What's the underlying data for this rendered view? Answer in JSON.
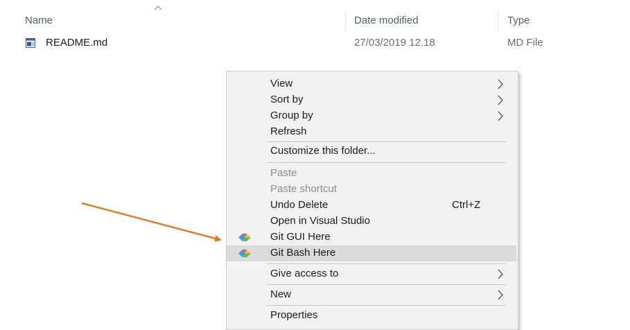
{
  "columns": {
    "name": "Name",
    "date_modified": "Date modified",
    "type": "Type"
  },
  "files": [
    {
      "name": "README.md",
      "date": "27/03/2019 12.18",
      "type": "MD File",
      "icon": "markdown-file-icon"
    }
  ],
  "context_menu": {
    "items": {
      "view": "View",
      "sort_by": "Sort by",
      "group_by": "Group by",
      "refresh": "Refresh",
      "customize": "Customize this folder...",
      "paste": "Paste",
      "paste_shortcut": "Paste shortcut",
      "undo_delete": "Undo Delete",
      "undo_delete_shortcut": "Ctrl+Z",
      "open_vs": "Open in Visual Studio",
      "git_gui": "Git GUI Here",
      "git_bash": "Git Bash Here",
      "give_access": "Give access to",
      "new": "New",
      "properties": "Properties"
    },
    "highlighted": "Git Bash Here"
  },
  "colors": {
    "arrow": "#e07b2a",
    "menu_bg": "#f2f2f2",
    "highlight_bg": "#dadada",
    "header_text": "#4c607a"
  }
}
